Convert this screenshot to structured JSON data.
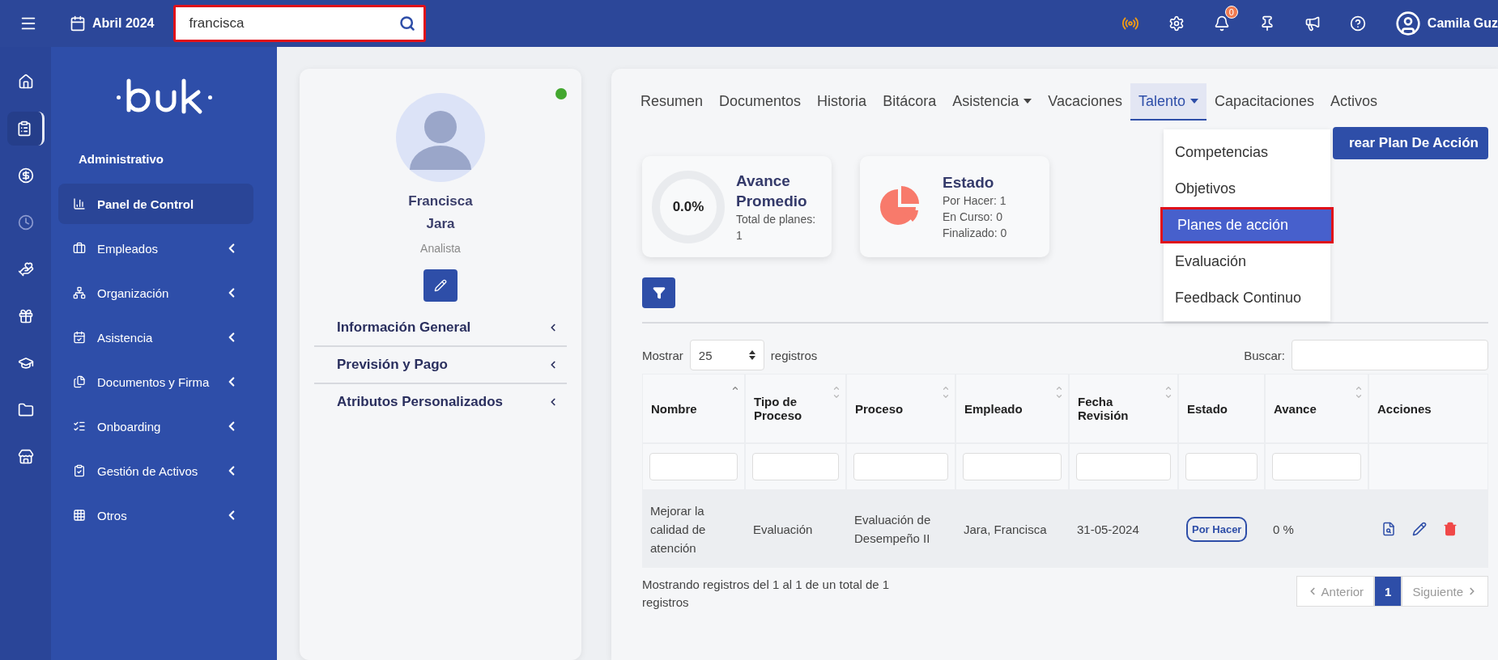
{
  "topbar": {
    "date": "Abril 2024",
    "search": {
      "value": "francisca",
      "highlighted": true
    },
    "notifications": "0",
    "user": "Camila Guz"
  },
  "rail": [
    {
      "selected": false,
      "disabled": false
    },
    {
      "selected": true,
      "disabled": false
    },
    {
      "selected": false,
      "disabled": false
    },
    {
      "selected": false,
      "disabled": true
    },
    {
      "selected": false,
      "disabled": false
    },
    {
      "selected": false,
      "disabled": false
    },
    {
      "selected": false,
      "disabled": false
    },
    {
      "selected": false,
      "disabled": false
    },
    {
      "selected": false,
      "disabled": false
    }
  ],
  "sidebar": {
    "section": "Administrativo",
    "items": [
      {
        "label": "Panel de Control",
        "selected": true,
        "expandable": false
      },
      {
        "label": "Empleados",
        "selected": false,
        "expandable": true
      },
      {
        "label": "Organización",
        "selected": false,
        "expandable": true
      },
      {
        "label": "Asistencia",
        "selected": false,
        "expandable": true
      },
      {
        "label": "Documentos y Firma",
        "selected": false,
        "expandable": true
      },
      {
        "label": "Onboarding",
        "selected": false,
        "expandable": true
      },
      {
        "label": "Gestión de Activos",
        "selected": false,
        "expandable": true
      },
      {
        "label": "Otros",
        "selected": false,
        "expandable": true
      }
    ]
  },
  "profile": {
    "online": true,
    "first_name": "Francisca",
    "last_name": "Jara",
    "role": "Analista",
    "sections": [
      "Información General",
      "Previsión y Pago",
      "Atributos Personalizados"
    ]
  },
  "tabs": [
    {
      "label": "Resumen",
      "selected": false,
      "dropdown": false
    },
    {
      "label": "Documentos",
      "selected": false,
      "dropdown": false
    },
    {
      "label": "Historia",
      "selected": false,
      "dropdown": false
    },
    {
      "label": "Bitácora",
      "selected": false,
      "dropdown": false
    },
    {
      "label": "Asistencia",
      "selected": false,
      "dropdown": true
    },
    {
      "label": "Vacaciones",
      "selected": false,
      "dropdown": false
    },
    {
      "label": "Talento",
      "selected": true,
      "dropdown": true
    },
    {
      "label": "Capacitaciones",
      "selected": false,
      "dropdown": false
    },
    {
      "label": "Activos",
      "selected": false,
      "dropdown": false
    }
  ],
  "dropdown": {
    "items": [
      {
        "label": "Competencias",
        "selected": false
      },
      {
        "label": "Objetivos",
        "selected": false
      },
      {
        "label": "Planes de acción",
        "selected": true
      },
      {
        "label": "Evaluación",
        "selected": false
      },
      {
        "label": "Feedback Continuo",
        "selected": false
      }
    ]
  },
  "create_button": "rear Plan De Acción",
  "stats": {
    "progress": {
      "title": "Avance Promedio",
      "value": "0.0%",
      "subtitle": "Total de planes: 1"
    },
    "status": {
      "title": "Estado",
      "lines": [
        "Por Hacer: 1",
        "En Curso: 0",
        "Finalizado: 0"
      ]
    }
  },
  "table": {
    "length_label": "Mostrar",
    "length_value": "25",
    "length_suffix": "registros",
    "search_label": "Buscar:",
    "columns": [
      {
        "label": "Nombre",
        "sortable": true,
        "sorted": true,
        "filter": true
      },
      {
        "label": "Tipo de Proceso",
        "sortable": true,
        "sorted": false,
        "filter": true
      },
      {
        "label": "Proceso",
        "sortable": true,
        "sorted": false,
        "filter": true
      },
      {
        "label": "Empleado",
        "sortable": true,
        "sorted": false,
        "filter": true
      },
      {
        "label": "Fecha Revisión",
        "sortable": true,
        "sorted": false,
        "filter": true
      },
      {
        "label": "Estado",
        "sortable": false,
        "sorted": false,
        "filter": true
      },
      {
        "label": "Avance",
        "sortable": true,
        "sorted": false,
        "filter": true
      },
      {
        "label": "Acciones",
        "sortable": false,
        "sorted": false,
        "filter": false
      }
    ],
    "rows": [
      {
        "name": "Mejorar la calidad de atención",
        "type": "Evaluación",
        "process": "Evaluación de Desempeño II",
        "employee": "Jara, Francisca",
        "date": "31-05-2024",
        "status": "Por Hacer",
        "progress": "0 %"
      }
    ],
    "info": "Mostrando registros del 1 al 1 de un total de 1 registros",
    "pagination": {
      "previous": "Anterior",
      "pages": [
        {
          "label": "1",
          "selected": true
        }
      ],
      "next": "Siguiente"
    }
  }
}
